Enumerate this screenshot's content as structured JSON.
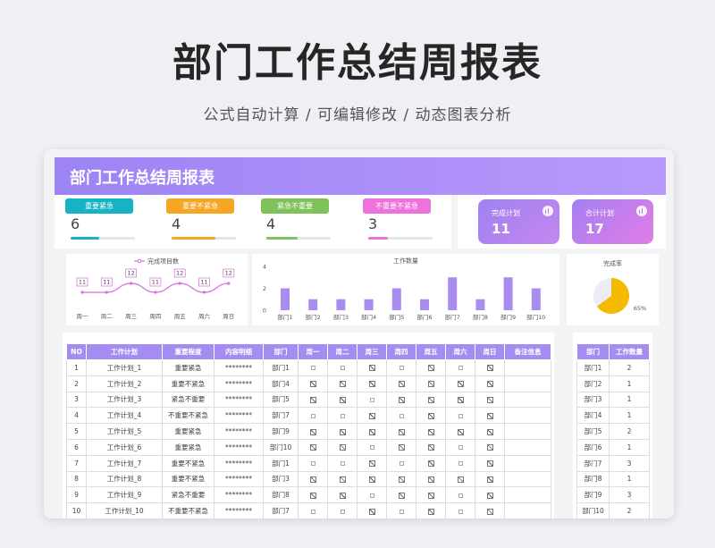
{
  "page": {
    "title": "部门工作总结周报表",
    "subtitle": "公式自动计算 /  可编辑修改  / 动态图表分析"
  },
  "sheet": {
    "header_title": "部门工作总结周报表",
    "kpis": [
      {
        "label": "重要紧急",
        "value": "6",
        "color": "#17b3c4",
        "progress": 0.45
      },
      {
        "label": "重要不紧急",
        "value": "4",
        "color": "#f5a623",
        "progress": 0.68
      },
      {
        "label": "紧急不重要",
        "value": "4",
        "color": "#7fc25b",
        "progress": 0.48
      },
      {
        "label": "不重要不紧急",
        "value": "3",
        "color": "#ee71dc",
        "progress": 0.3
      }
    ],
    "totals": [
      {
        "label": "完成计划",
        "value": "11"
      },
      {
        "label": "合计计划",
        "value": "17"
      }
    ],
    "line_chart": {
      "legend": "完成项目数",
      "categories": [
        "周一",
        "周二",
        "周三",
        "周四",
        "周五",
        "周六",
        "周日"
      ],
      "values": [
        11,
        11,
        12,
        11,
        12,
        11,
        12
      ],
      "color": "#d96adf"
    },
    "bar_chart": {
      "title": "工作数量",
      "categories": [
        "部门1",
        "部门2",
        "部门3",
        "部门4",
        "部门5",
        "部门6",
        "部门7",
        "部门8",
        "部门9",
        "部门10"
      ],
      "values": [
        2,
        1,
        1,
        1,
        2,
        1,
        3,
        1,
        3,
        2
      ],
      "yticks": [
        "0",
        "2",
        "4"
      ],
      "ylim": [
        0,
        4
      ],
      "color": "#a98cf0"
    },
    "pie_chart": {
      "title": "完成率",
      "value": 0.65,
      "label": "65%",
      "color": "#f5b900",
      "rest_color": "#ececf5"
    },
    "table": {
      "headers": [
        "NO",
        "工作计划",
        "重要程度",
        "内容明细",
        "部门",
        "周一",
        "周二",
        "周三",
        "周四",
        "周五",
        "周六",
        "周日",
        "备注信息"
      ],
      "rows": [
        {
          "no": "1",
          "plan": "工作计划_1",
          "level": "重要紧急",
          "detail": "********",
          "dept": "部门1",
          "days": [
            0,
            0,
            1,
            0,
            1,
            0,
            1
          ]
        },
        {
          "no": "2",
          "plan": "工作计划_2",
          "level": "重要不紧急",
          "detail": "********",
          "dept": "部门4",
          "days": [
            1,
            1,
            1,
            1,
            1,
            1,
            1
          ]
        },
        {
          "no": "3",
          "plan": "工作计划_3",
          "level": "紧急不重要",
          "detail": "********",
          "dept": "部门5",
          "days": [
            1,
            1,
            0,
            1,
            1,
            1,
            1
          ]
        },
        {
          "no": "4",
          "plan": "工作计划_4",
          "level": "不重要不紧急",
          "detail": "********",
          "dept": "部门7",
          "days": [
            0,
            0,
            1,
            0,
            1,
            0,
            1
          ]
        },
        {
          "no": "5",
          "plan": "工作计划_5",
          "level": "重要紧急",
          "detail": "********",
          "dept": "部门9",
          "days": [
            1,
            1,
            1,
            1,
            1,
            1,
            1
          ]
        },
        {
          "no": "6",
          "plan": "工作计划_6",
          "level": "重要紧急",
          "detail": "********",
          "dept": "部门10",
          "days": [
            1,
            1,
            0,
            1,
            1,
            0,
            1
          ]
        },
        {
          "no": "7",
          "plan": "工作计划_7",
          "level": "重要不紧急",
          "detail": "********",
          "dept": "部门1",
          "days": [
            0,
            0,
            1,
            0,
            1,
            0,
            1
          ]
        },
        {
          "no": "8",
          "plan": "工作计划_8",
          "level": "重要不紧急",
          "detail": "********",
          "dept": "部门3",
          "days": [
            1,
            1,
            1,
            1,
            1,
            1,
            1
          ]
        },
        {
          "no": "9",
          "plan": "工作计划_9",
          "level": "紧急不重要",
          "detail": "********",
          "dept": "部门8",
          "days": [
            1,
            1,
            0,
            1,
            1,
            0,
            1
          ]
        },
        {
          "no": "10",
          "plan": "工作计划_10",
          "level": "不重要不紧急",
          "detail": "********",
          "dept": "部门7",
          "days": [
            0,
            0,
            1,
            0,
            1,
            0,
            1
          ]
        }
      ]
    },
    "side_table": {
      "headers": [
        "部门",
        "工作数量"
      ],
      "rows": [
        [
          "部门1",
          "2"
        ],
        [
          "部门2",
          "1"
        ],
        [
          "部门3",
          "1"
        ],
        [
          "部门4",
          "1"
        ],
        [
          "部门5",
          "2"
        ],
        [
          "部门6",
          "1"
        ],
        [
          "部门7",
          "3"
        ],
        [
          "部门8",
          "1"
        ],
        [
          "部门9",
          "3"
        ],
        [
          "部门10",
          "2"
        ]
      ]
    }
  }
}
